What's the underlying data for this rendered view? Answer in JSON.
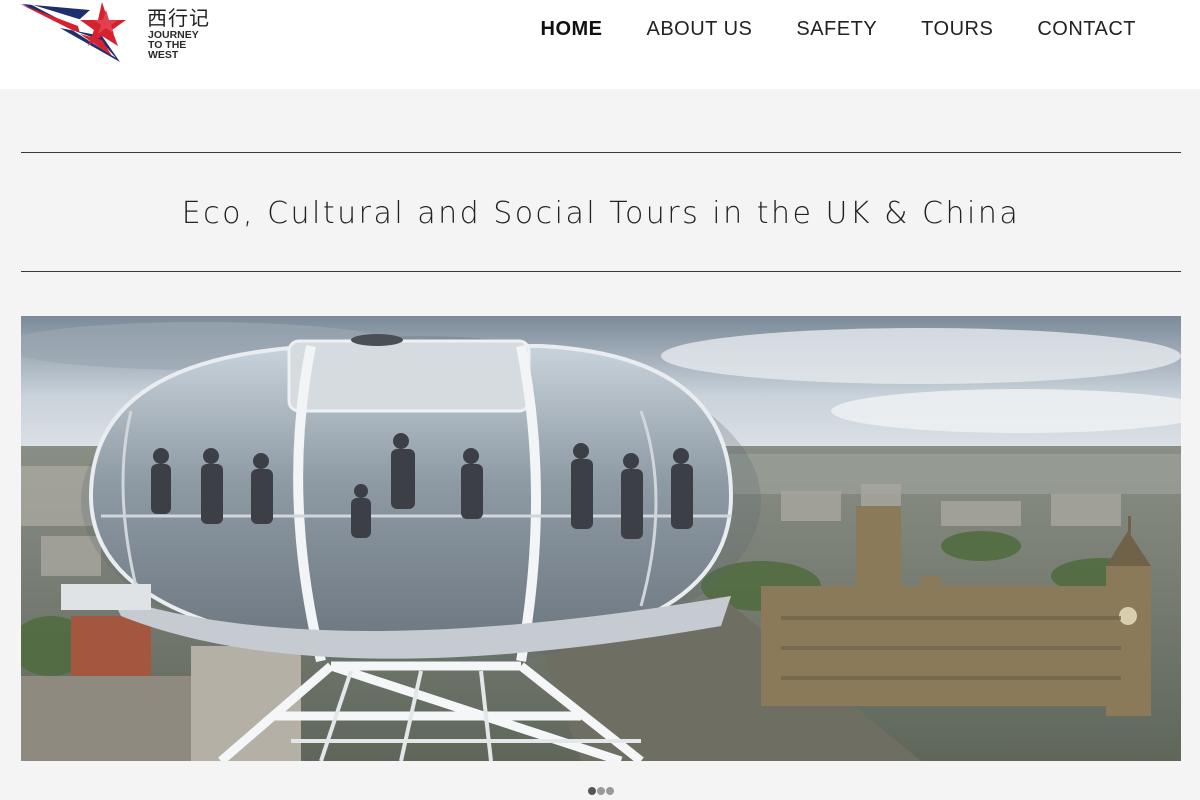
{
  "brand": {
    "chinese_name": "西行记",
    "english_name_lines": [
      "JOURNEY",
      "TO THE",
      "WEST"
    ],
    "colors": {
      "red": "#d7212f",
      "blue": "#1e2f6d"
    }
  },
  "nav": {
    "items": [
      {
        "label": "HOME",
        "active": true
      },
      {
        "label": "ABOUT US",
        "active": false
      },
      {
        "label": "SAFETY",
        "active": false
      },
      {
        "label": "TOURS",
        "active": false
      },
      {
        "label": "CONTACT",
        "active": false
      }
    ]
  },
  "tagline": "Eco, Cultural and Social Tours in the UK & China",
  "slider": {
    "slide_count": 3,
    "active_index": 0,
    "image_description_icon": "london-eye-capsule-photo"
  }
}
